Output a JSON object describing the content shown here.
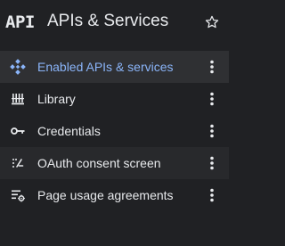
{
  "header": {
    "logo_text": "API",
    "title": "APIs & Services",
    "star_icon": "star-outline-icon"
  },
  "colors": {
    "background": "#202124",
    "text": "#e8eaed",
    "active_text": "#8ab4f8",
    "active_background": "#2f3033",
    "icon": "#e8eaed",
    "active_icon": "#8ab4f8"
  },
  "menu": {
    "items": [
      {
        "label": "Enabled APIs & services",
        "icon": "api-diamond-icon",
        "active": true
      },
      {
        "label": "Library",
        "icon": "library-icon",
        "active": false
      },
      {
        "label": "Credentials",
        "icon": "key-icon",
        "active": false
      },
      {
        "label": "OAuth consent screen",
        "icon": "oauth-consent-icon",
        "active": false
      },
      {
        "label": "Page usage agreements",
        "icon": "settings-list-icon",
        "active": false
      }
    ],
    "more_icon": "more-vert-icon"
  }
}
